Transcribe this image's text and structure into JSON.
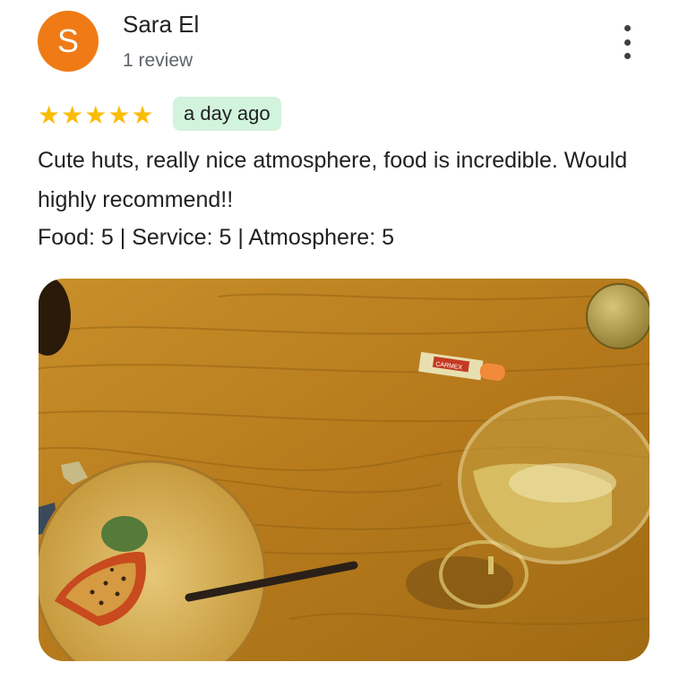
{
  "reviewer": {
    "avatar_letter": "S",
    "avatar_color": "#f07b16",
    "name": "Sara El",
    "review_count": "1 review"
  },
  "menu": {
    "icon": "more-vert-icon"
  },
  "rating": {
    "stars": 5,
    "max": 5,
    "star_color": "#fbbc04"
  },
  "time_badge": {
    "text": "a day ago",
    "color": "#d2f3dc"
  },
  "review_text": "Cute huts, really nice atmosphere, food is incredible. Would highly recommend!!",
  "sub_ratings": [
    {
      "label": "Food",
      "value": "5"
    },
    {
      "label": "Service",
      "value": "5"
    },
    {
      "label": "Atmosphere",
      "value": "5"
    }
  ],
  "sub_ratings_separator": ": ",
  "sub_ratings_divider": " | ",
  "photo": {
    "lip_balm_label": "CARMEX"
  }
}
